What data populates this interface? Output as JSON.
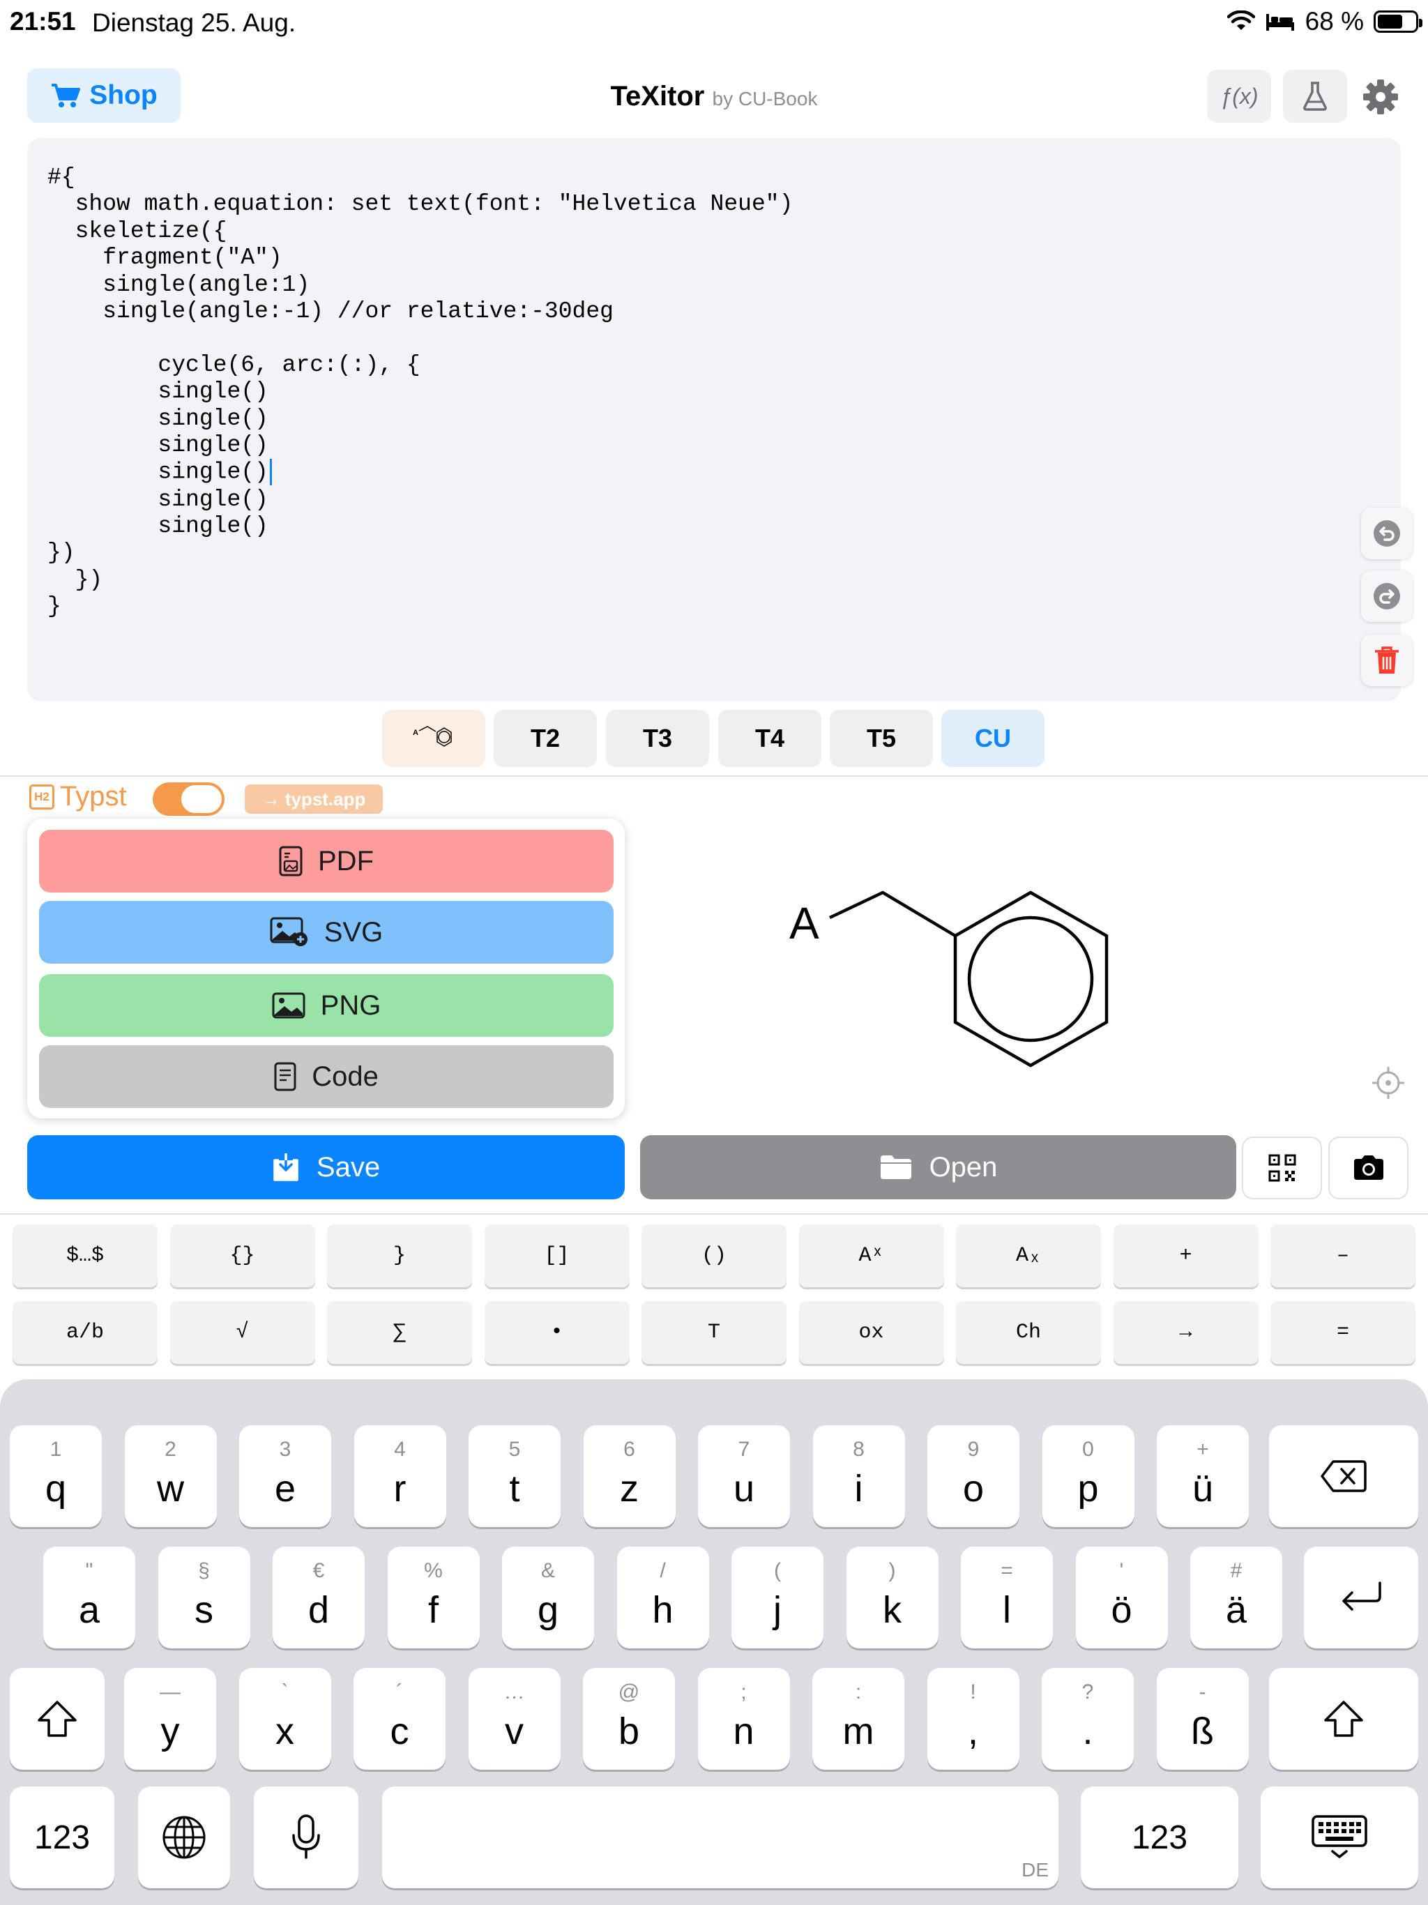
{
  "status": {
    "time": "21:51",
    "date": "Dienstag 25. Aug.",
    "battery": "68 %",
    "battery_level": 0.68
  },
  "header": {
    "shop_label": "Shop",
    "title": "TeXitor",
    "subtitle": "by CU-Book",
    "fx_label": "ƒ(x)"
  },
  "editor": {
    "code": "#{\n  show math.equation: set text(font: \"Helvetica Neue\")\n  skeletize({\n    fragment(\"A\")\n    single(angle:1)\n    single(angle:-1) //or relative:-30deg\n\n        cycle(6, arc:(:), {\n        single()\n        single()\n        single()\n        single()",
    "code_after_caret": "\n        single()\n        single()\n})\n  })\n}"
  },
  "tabs": [
    {
      "label": "T2"
    },
    {
      "label": "T3"
    },
    {
      "label": "T4"
    },
    {
      "label": "T5"
    },
    {
      "label": "CU"
    }
  ],
  "typst": {
    "label": "Typst",
    "h2": "H2",
    "link": "→ typst.app",
    "enabled": true
  },
  "export": {
    "pdf": "PDF",
    "svg": "SVG",
    "png": "PNG",
    "code": "Code"
  },
  "preview": {
    "fragment_label": "A"
  },
  "actions": {
    "save": "Save",
    "open": "Open"
  },
  "symbols": {
    "row1": [
      "$…$",
      "{}",
      "}",
      "[]",
      "()",
      "Aˣ",
      "Aₓ",
      "+",
      "–"
    ],
    "row2": [
      "a/b",
      "√",
      "∑",
      "•",
      "T",
      "ox",
      "Ch",
      "→",
      "="
    ]
  },
  "keyboard": {
    "row1": [
      {
        "hint": "1",
        "key": "q"
      },
      {
        "hint": "2",
        "key": "w"
      },
      {
        "hint": "3",
        "key": "e"
      },
      {
        "hint": "4",
        "key": "r"
      },
      {
        "hint": "5",
        "key": "t"
      },
      {
        "hint": "6",
        "key": "z"
      },
      {
        "hint": "7",
        "key": "u"
      },
      {
        "hint": "8",
        "key": "i"
      },
      {
        "hint": "9",
        "key": "o"
      },
      {
        "hint": "0",
        "key": "p"
      },
      {
        "hint": "+",
        "key": "ü"
      }
    ],
    "row2": [
      {
        "hint": "\"",
        "key": "a"
      },
      {
        "hint": "§",
        "key": "s"
      },
      {
        "hint": "€",
        "key": "d"
      },
      {
        "hint": "%",
        "key": "f"
      },
      {
        "hint": "&",
        "key": "g"
      },
      {
        "hint": "/",
        "key": "h"
      },
      {
        "hint": "(",
        "key": "j"
      },
      {
        "hint": ")",
        "key": "k"
      },
      {
        "hint": "=",
        "key": "l"
      },
      {
        "hint": "'",
        "key": "ö"
      },
      {
        "hint": "#",
        "key": "ä"
      }
    ],
    "row3": [
      {
        "hint": "—",
        "key": "y"
      },
      {
        "hint": "`",
        "key": "x"
      },
      {
        "hint": "´",
        "key": "c"
      },
      {
        "hint": "…",
        "key": "v"
      },
      {
        "hint": "@",
        "key": "b"
      },
      {
        "hint": ";",
        "key": "n"
      },
      {
        "hint": ":",
        "key": "m"
      },
      {
        "hint": "!",
        "key": ","
      },
      {
        "hint": "?",
        "key": "."
      },
      {
        "hint": "-",
        "key": "ß"
      }
    ],
    "numbers_label": "123",
    "language": "DE"
  }
}
